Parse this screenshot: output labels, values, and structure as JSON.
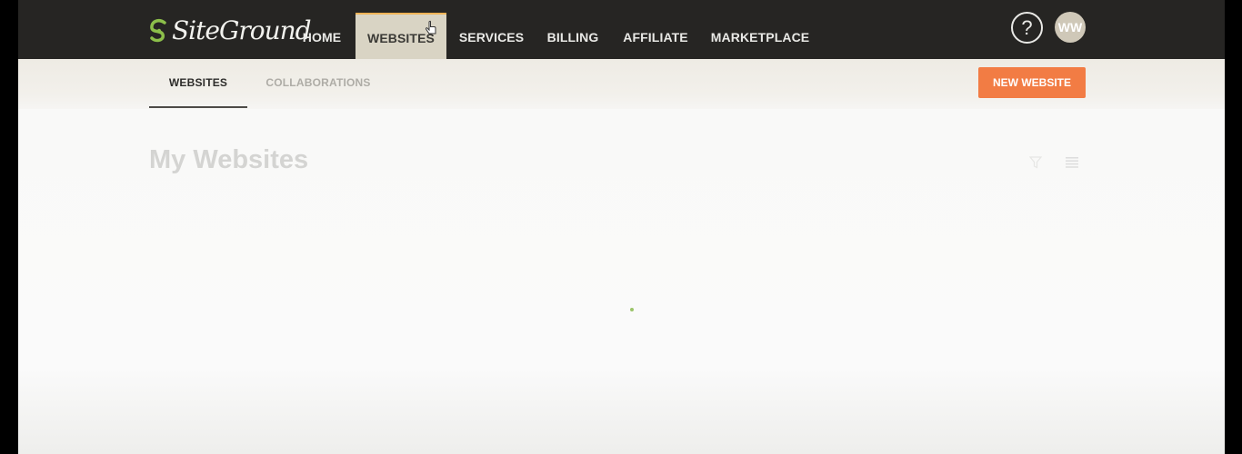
{
  "brand": {
    "name": "SiteGround"
  },
  "colors": {
    "topbar": "#262523",
    "accent": "#f27c44",
    "active_tab": "#d9d4c4",
    "logo_green": "#8cbf4a"
  },
  "nav": {
    "items": [
      {
        "label": "HOME",
        "active": false
      },
      {
        "label": "WEBSITES",
        "active": true
      },
      {
        "label": "SERVICES",
        "active": false
      },
      {
        "label": "BILLING",
        "active": false
      },
      {
        "label": "AFFILIATE",
        "active": false
      },
      {
        "label": "MARKETPLACE",
        "active": false
      }
    ],
    "help_icon": "question-mark-icon",
    "user_initials": "WW"
  },
  "subnav": {
    "tabs": [
      {
        "label": "WEBSITES",
        "active": true
      },
      {
        "label": "COLLABORATIONS",
        "active": false
      }
    ],
    "new_website_label": "NEW WEBSITE"
  },
  "main": {
    "title": "My Websites",
    "icons": [
      "filter-icon",
      "list-view-icon"
    ],
    "loading": true
  }
}
